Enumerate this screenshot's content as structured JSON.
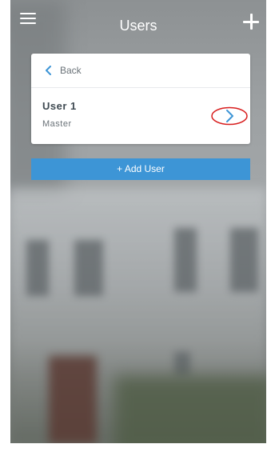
{
  "header": {
    "title": "Users",
    "menu_icon": "hamburger-menu-icon",
    "add_icon": "plus-icon"
  },
  "card": {
    "back_label": "Back",
    "back_icon": "chevron-left-icon",
    "users": [
      {
        "name": "User 1",
        "role": "Master",
        "icon": "chevron-right-icon"
      }
    ]
  },
  "add_user_label": "+ Add User",
  "colors": {
    "accent": "#3d95d6",
    "highlight_circle": "#d81e1e",
    "title_text": "#ffffff"
  }
}
